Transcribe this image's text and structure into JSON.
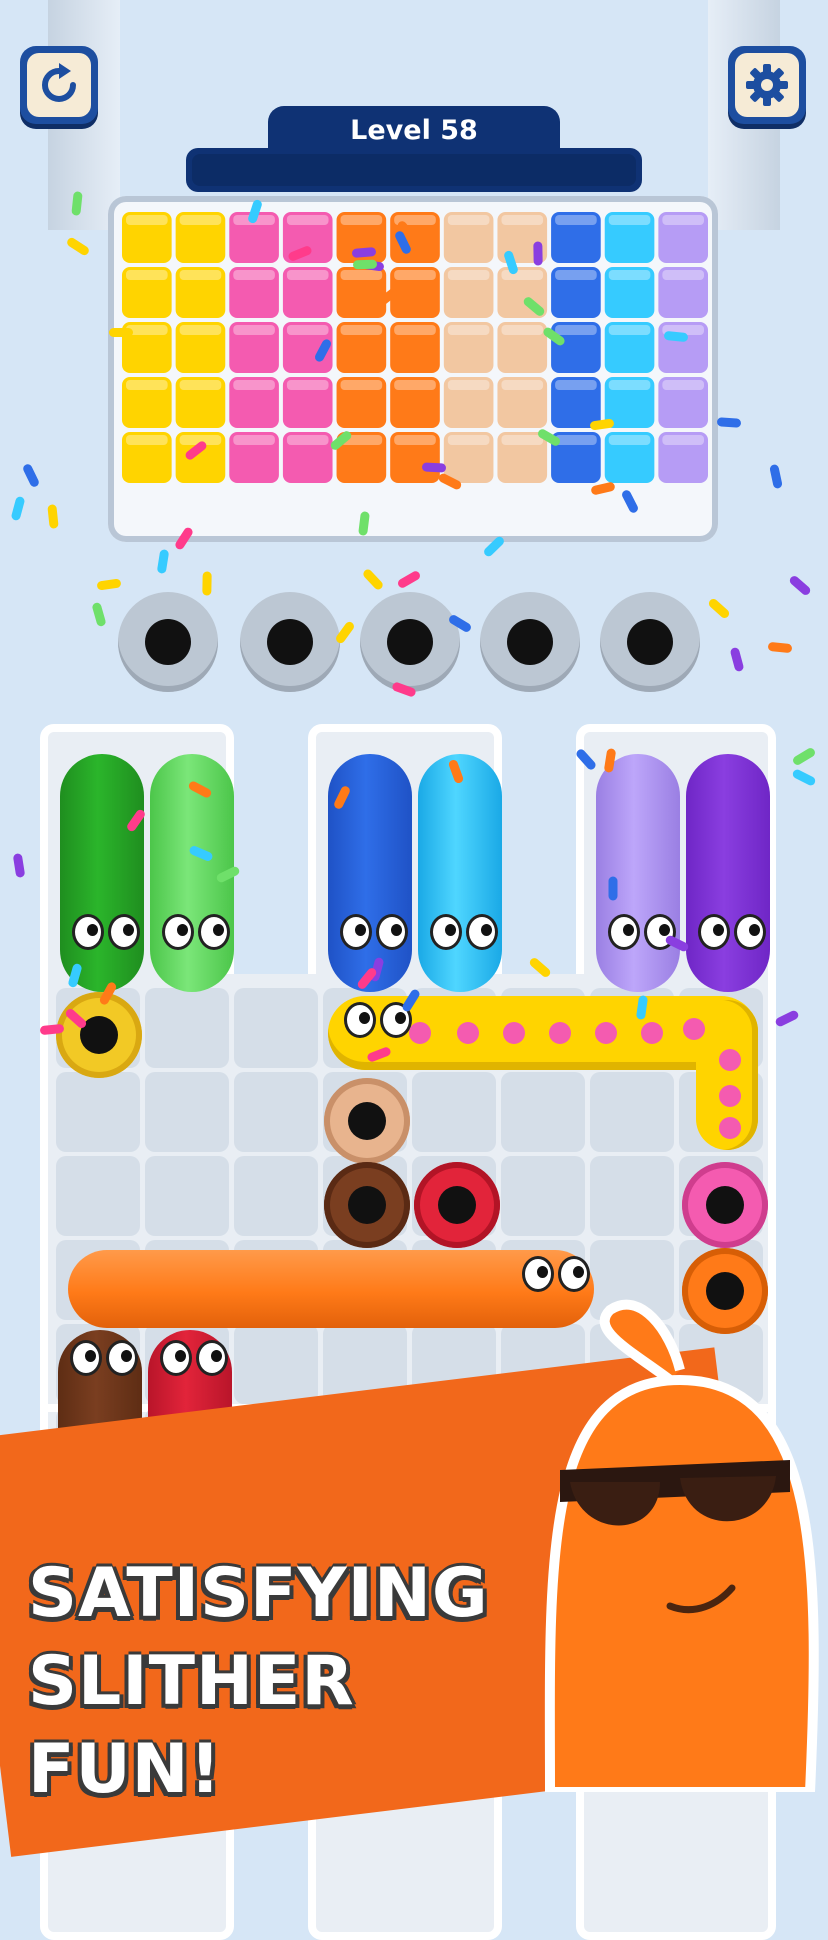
{
  "header": {
    "level_label": "Level 58",
    "progress": 0.0,
    "restart_icon": "restart-icon",
    "settings_icon": "gear-icon"
  },
  "colors": {
    "background": "#d6e6f6",
    "navy": "#0f3274",
    "yellow": "#ffd400",
    "pink": "#f45bb0",
    "orange": "#ff7a18",
    "tan": "#f2c7a1",
    "blue": "#2f6ee8",
    "cyan": "#36cbff",
    "lavender": "#b69cf5",
    "green": "#2bb52b",
    "lightgreen": "#6fe06a",
    "violet": "#8a3ee0",
    "brown": "#7a3e20",
    "red": "#e2243a"
  },
  "block_columns": [
    "yellow",
    "yellow",
    "pink",
    "pink",
    "orange",
    "orange",
    "tan",
    "tan",
    "blue",
    "cyan",
    "lavender"
  ],
  "tagline": {
    "line1": "SATISFYING",
    "line2": "SLITHER FUN!"
  },
  "mascot": {
    "icon": "mascot-sunglasses-icon"
  }
}
